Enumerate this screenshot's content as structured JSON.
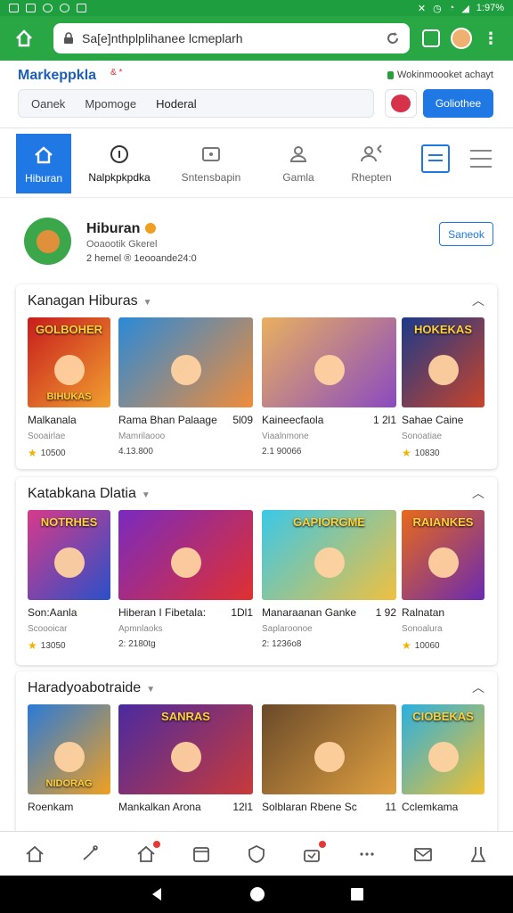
{
  "status_bar": {
    "time": "1:97%"
  },
  "browser": {
    "url": "Sa[e]nt​hplplihanee lcmeplarh"
  },
  "site": {
    "brand": "Markeppkla",
    "brand_mark": "& *",
    "secure_text": "Wokinmoooket achayt",
    "search_tabs": [
      "Oanek",
      "Mpomoge",
      "Hoderal"
    ],
    "cta_label": "Goliothee"
  },
  "category_nav": [
    {
      "label": "Hiburan",
      "icon": "home-icon"
    },
    {
      "label": "Nalpkpkpdka",
      "icon": "info-icon"
    },
    {
      "label": "Sntensbapin",
      "icon": "media-icon"
    },
    {
      "label": "Gamla",
      "icon": "user-icon"
    },
    {
      "label": "Rhepten",
      "icon": "person-plus-icon"
    }
  ],
  "profile": {
    "name": "Hiburan",
    "sub1": "Ooaootik Gkerel",
    "sub2": "2 hemel ® 1eooande24:0",
    "follow_label": "Saneok"
  },
  "sections": [
    {
      "title": "Kanagan Hiburas",
      "items": [
        {
          "title": "Malkanala",
          "extra": "",
          "sub": "Sooairlae",
          "rating": "10500",
          "star": true,
          "thumb_title": "GOLBOHER",
          "thumb_caption": "BIHUKAS",
          "colors": [
            "#c81c1c",
            "#f0a030"
          ]
        },
        {
          "title": "Rama Bhan Palaage",
          "extra": "5l09",
          "sub": "Mamrilaooo",
          "rating": "4.13.800",
          "star": false,
          "thumb_title": "",
          "thumb_caption": "",
          "colors": [
            "#2a8ad8",
            "#f08c3a"
          ]
        },
        {
          "title": "Kaineecfaola",
          "extra": "1 2l1",
          "sub": "Viaalnmone",
          "rating": "2.1 90066",
          "star": false,
          "thumb_title": "",
          "thumb_caption": "",
          "colors": [
            "#e8b060",
            "#8a4ac0"
          ]
        },
        {
          "title": "Sahae Caine",
          "extra": "",
          "sub": "Sonoatiae",
          "rating": "10830",
          "star": true,
          "thumb_title": "HOKEKAS",
          "thumb_caption": "",
          "colors": [
            "#1c3a8a",
            "#c8442a"
          ]
        }
      ]
    },
    {
      "title": "Katabkana Dlatia",
      "items": [
        {
          "title": "Son:Aanla",
          "extra": "",
          "sub": "Scoooicar",
          "rating": "13050",
          "star": true,
          "thumb_title": "NOTRHES",
          "thumb_caption": "",
          "colors": [
            "#d83a8a",
            "#2a50c8"
          ]
        },
        {
          "title": "Hiberan I Fibetala:",
          "extra": "1Dl1",
          "sub": "Apmnlaoks",
          "rating": "2: 2180tg",
          "star": false,
          "thumb_title": "",
          "thumb_caption": "",
          "colors": [
            "#7a2ac0",
            "#e03030"
          ]
        },
        {
          "title": "Manaraanan Ganke",
          "extra": "1 92",
          "sub": "Saplaroonoe",
          "rating": "2: 1236o8",
          "star": false,
          "thumb_title": "GAPIORGME",
          "thumb_caption": "",
          "colors": [
            "#3ac8e8",
            "#f0c040"
          ]
        },
        {
          "title": "Ralnatan",
          "extra": "",
          "sub": "Sonoalura",
          "rating": "10060",
          "star": true,
          "thumb_title": "RAIANKES",
          "thumb_caption": "",
          "colors": [
            "#e86a1a",
            "#6a2ab0"
          ]
        }
      ]
    },
    {
      "title": "Haradyoabotraide",
      "items": [
        {
          "title": "Roenkam",
          "extra": "",
          "sub": "",
          "rating": "",
          "star": false,
          "thumb_title": "",
          "thumb_caption": "NIDORAG",
          "colors": [
            "#2a7ad8",
            "#f0a020"
          ]
        },
        {
          "title": "Mankalkan Arona",
          "extra": "12l1",
          "sub": "",
          "rating": "",
          "star": false,
          "thumb_title": "SANRAS",
          "thumb_caption": "",
          "colors": [
            "#4a2aa0",
            "#c83a3a"
          ]
        },
        {
          "title": "Solblaran Rbene Sc",
          "extra": "11",
          "sub": "",
          "rating": "",
          "star": false,
          "thumb_title": "",
          "thumb_caption": "",
          "colors": [
            "#6a4a2a",
            "#e0a040"
          ]
        },
        {
          "title": "Cclemkama",
          "extra": "",
          "sub": "",
          "rating": "",
          "star": false,
          "thumb_title": "CIOBEKAS",
          "thumb_caption": "",
          "colors": [
            "#2ab0e0",
            "#f0c030"
          ]
        }
      ]
    }
  ],
  "bottom_nav": [
    "home-icon",
    "phone-icon",
    "notification-home-icon",
    "calendar-icon",
    "shield-icon",
    "gift-icon",
    "more-icon",
    "mail-icon",
    "profile-icon"
  ]
}
